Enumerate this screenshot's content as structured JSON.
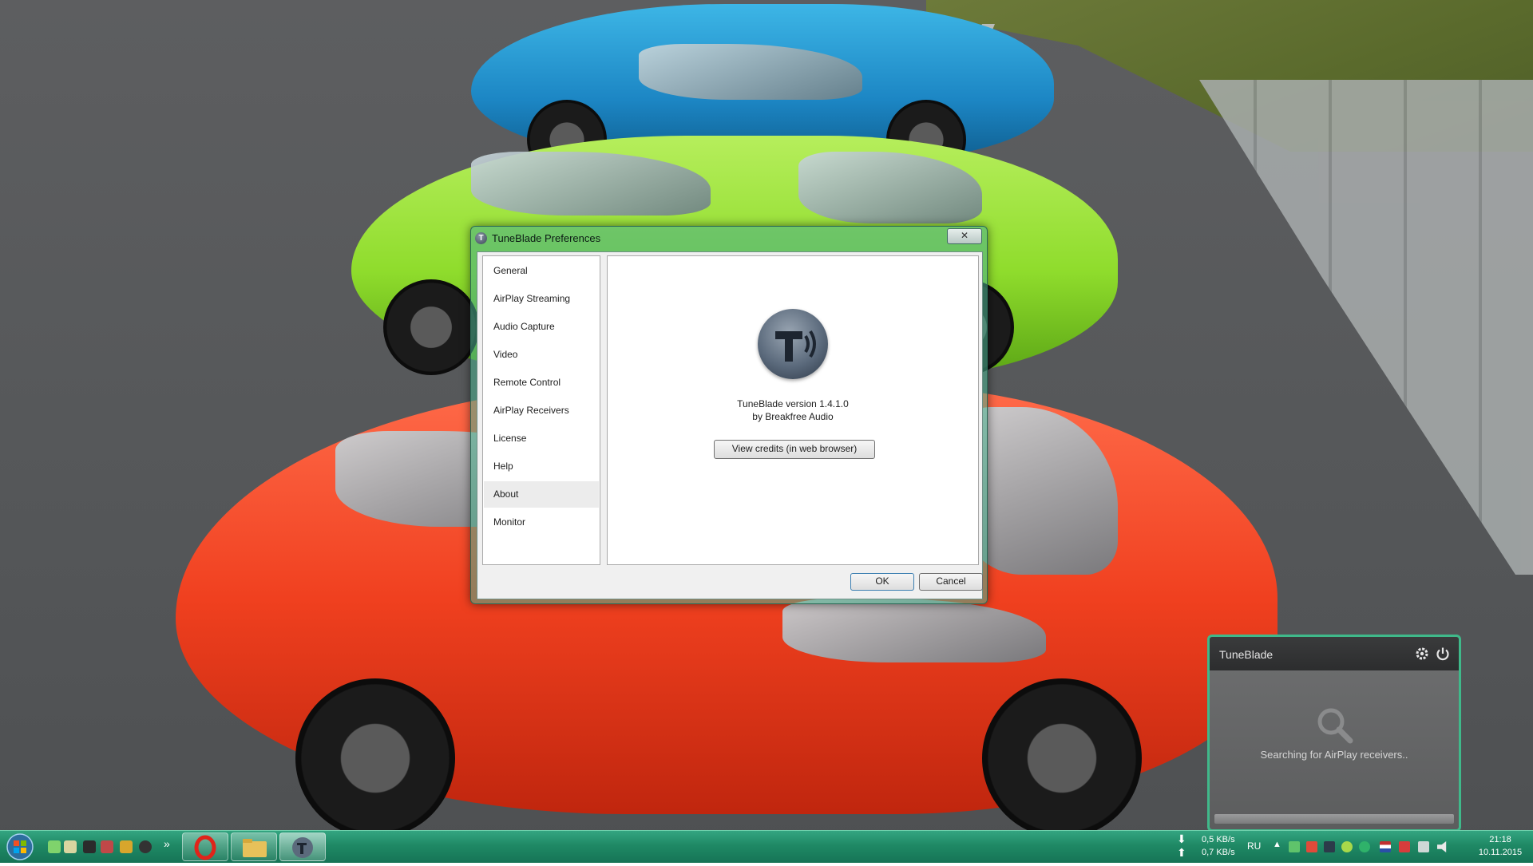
{
  "preferences": {
    "title": "TuneBlade Preferences",
    "close_glyph": "✕",
    "sidebar_items": [
      {
        "label": "General"
      },
      {
        "label": "AirPlay Streaming"
      },
      {
        "label": "Audio Capture"
      },
      {
        "label": "Video"
      },
      {
        "label": "Remote Control"
      },
      {
        "label": "AirPlay Receivers"
      },
      {
        "label": "License"
      },
      {
        "label": "Help"
      },
      {
        "label": "About"
      },
      {
        "label": "Monitor"
      }
    ],
    "selected_item": "About",
    "about": {
      "version_text": "TuneBlade version 1.4.1.0",
      "author_text": "by Breakfree Audio",
      "credits_button": "View credits (in web browser)"
    },
    "ok_button": "OK",
    "cancel_button": "Cancel"
  },
  "widget": {
    "title": "TuneBlade",
    "status": "Searching for AirPlay receivers..",
    "icons": [
      "gear-icon",
      "power-icon",
      "search-icon"
    ]
  },
  "taskbar": {
    "network_down": "0,5 KB/s",
    "network_up": "0,7 KB/s",
    "language": "RU",
    "time": "21:18",
    "date": "10.11.2015",
    "accent_color": "#1f8965"
  }
}
